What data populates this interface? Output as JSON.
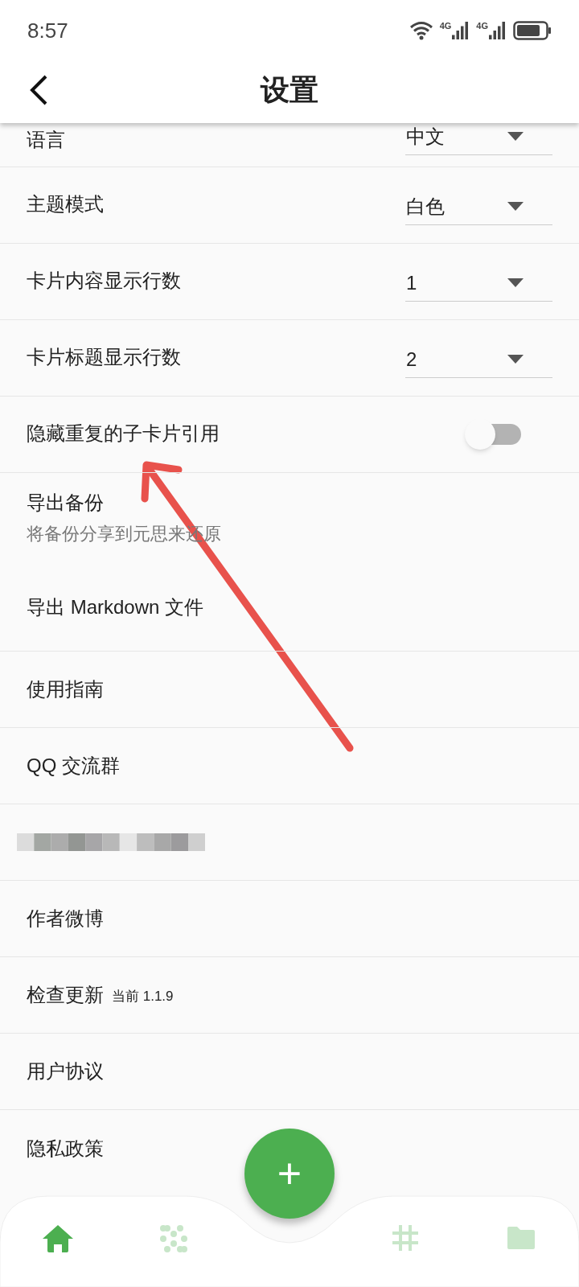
{
  "status_bar": {
    "time": "8:57",
    "network_1": "4G",
    "network_2": "4G"
  },
  "header": {
    "title": "设置"
  },
  "rows": [
    {
      "kind": "dropdown",
      "label": "语言",
      "value": "中文",
      "divider_below": true
    },
    {
      "kind": "dropdown",
      "label": "主题模式",
      "value": "白色",
      "divider_below": true
    },
    {
      "kind": "dropdown",
      "label": "卡片内容显示行数",
      "value": "1",
      "divider_below": true
    },
    {
      "kind": "dropdown",
      "label": "卡片标题显示行数",
      "value": "2",
      "divider_below": true
    },
    {
      "kind": "toggle",
      "label": "隐藏重复的子卡片引用",
      "on": false,
      "divider_below": true
    },
    {
      "kind": "subtitle",
      "label": "导出备份",
      "subtitle": "将备份分享到元思来还原",
      "divider_below": false
    },
    {
      "kind": "plain",
      "label": "导出 Markdown 文件",
      "divider_below": true
    },
    {
      "kind": "plain",
      "label": "使用指南",
      "divider_below": true
    },
    {
      "kind": "plain",
      "label": "QQ 交流群",
      "divider_below": true
    },
    {
      "kind": "redacted",
      "divider_below": true
    },
    {
      "kind": "plain",
      "label": "作者微博",
      "divider_below": true
    },
    {
      "kind": "version",
      "label": "检查更新",
      "note": "当前 1.1.9",
      "divider_below": true
    },
    {
      "kind": "plain",
      "label": "用户协议",
      "divider_below": true
    },
    {
      "kind": "plain",
      "label": "隐私政策",
      "divider_below": false
    }
  ],
  "bottom_nav": {
    "items": [
      {
        "kind": "home",
        "selected": true
      },
      {
        "kind": "dots",
        "selected": false
      },
      {
        "kind": "hash",
        "selected": false
      },
      {
        "kind": "folder",
        "selected": false
      }
    ],
    "fab": "+"
  }
}
